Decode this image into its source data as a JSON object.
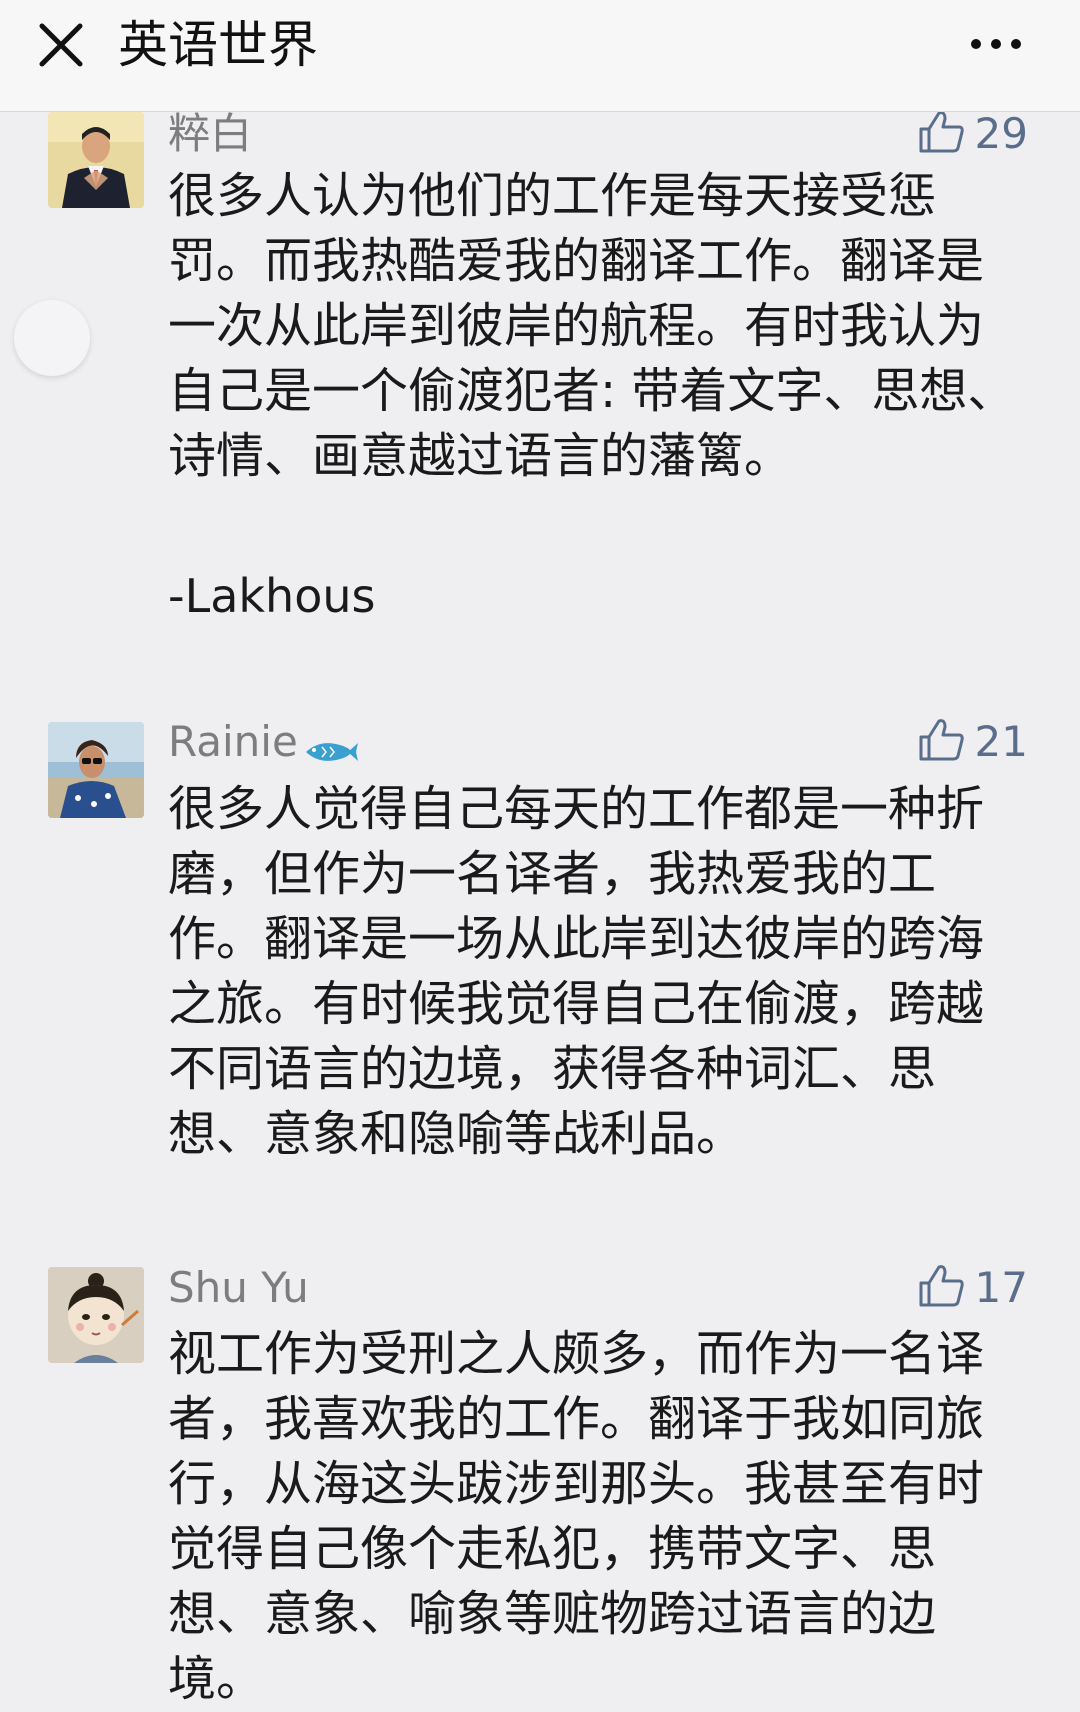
{
  "header": {
    "title": "英语世界"
  },
  "comments": [
    {
      "username": "粹白",
      "likes": "29",
      "text": "很多人认为他们的工作是每天接受惩罚。而我热酷爱我的翻译工作。翻译是一次从此岸到彼岸的航程。有时我认为自己是一个偷渡犯者: 带着文字、思想、诗情、画意越过语言的藩篱。",
      "signature": "-Lakhous"
    },
    {
      "username": "Rainie",
      "likes": "21",
      "text": "很多人觉得自己每天的工作都是一种折磨，但作为一名译者，我热爱我的工作。翻译是一场从此岸到达彼岸的跨海之旅。有时候我觉得自己在偷渡，跨越不同语言的边境，获得各种词汇、思想、意象和隐喻等战利品。"
    },
    {
      "username": "Shu Yu",
      "likes": "17",
      "text": "视工作为受刑之人颇多，而作为一名译者，我喜欢我的工作。翻译于我如同旅行，从海这头跋涉到那头。我甚至有时觉得自己像个走私犯，携带文字、思想、意象、喻象等赃物跨过语言的边境。"
    }
  ],
  "colors": {
    "background": "#efeff2",
    "header_bg": "#f7f7f7",
    "username": "#7d7d7d",
    "like": "#5a6e8c",
    "text": "#1a1a1a"
  }
}
